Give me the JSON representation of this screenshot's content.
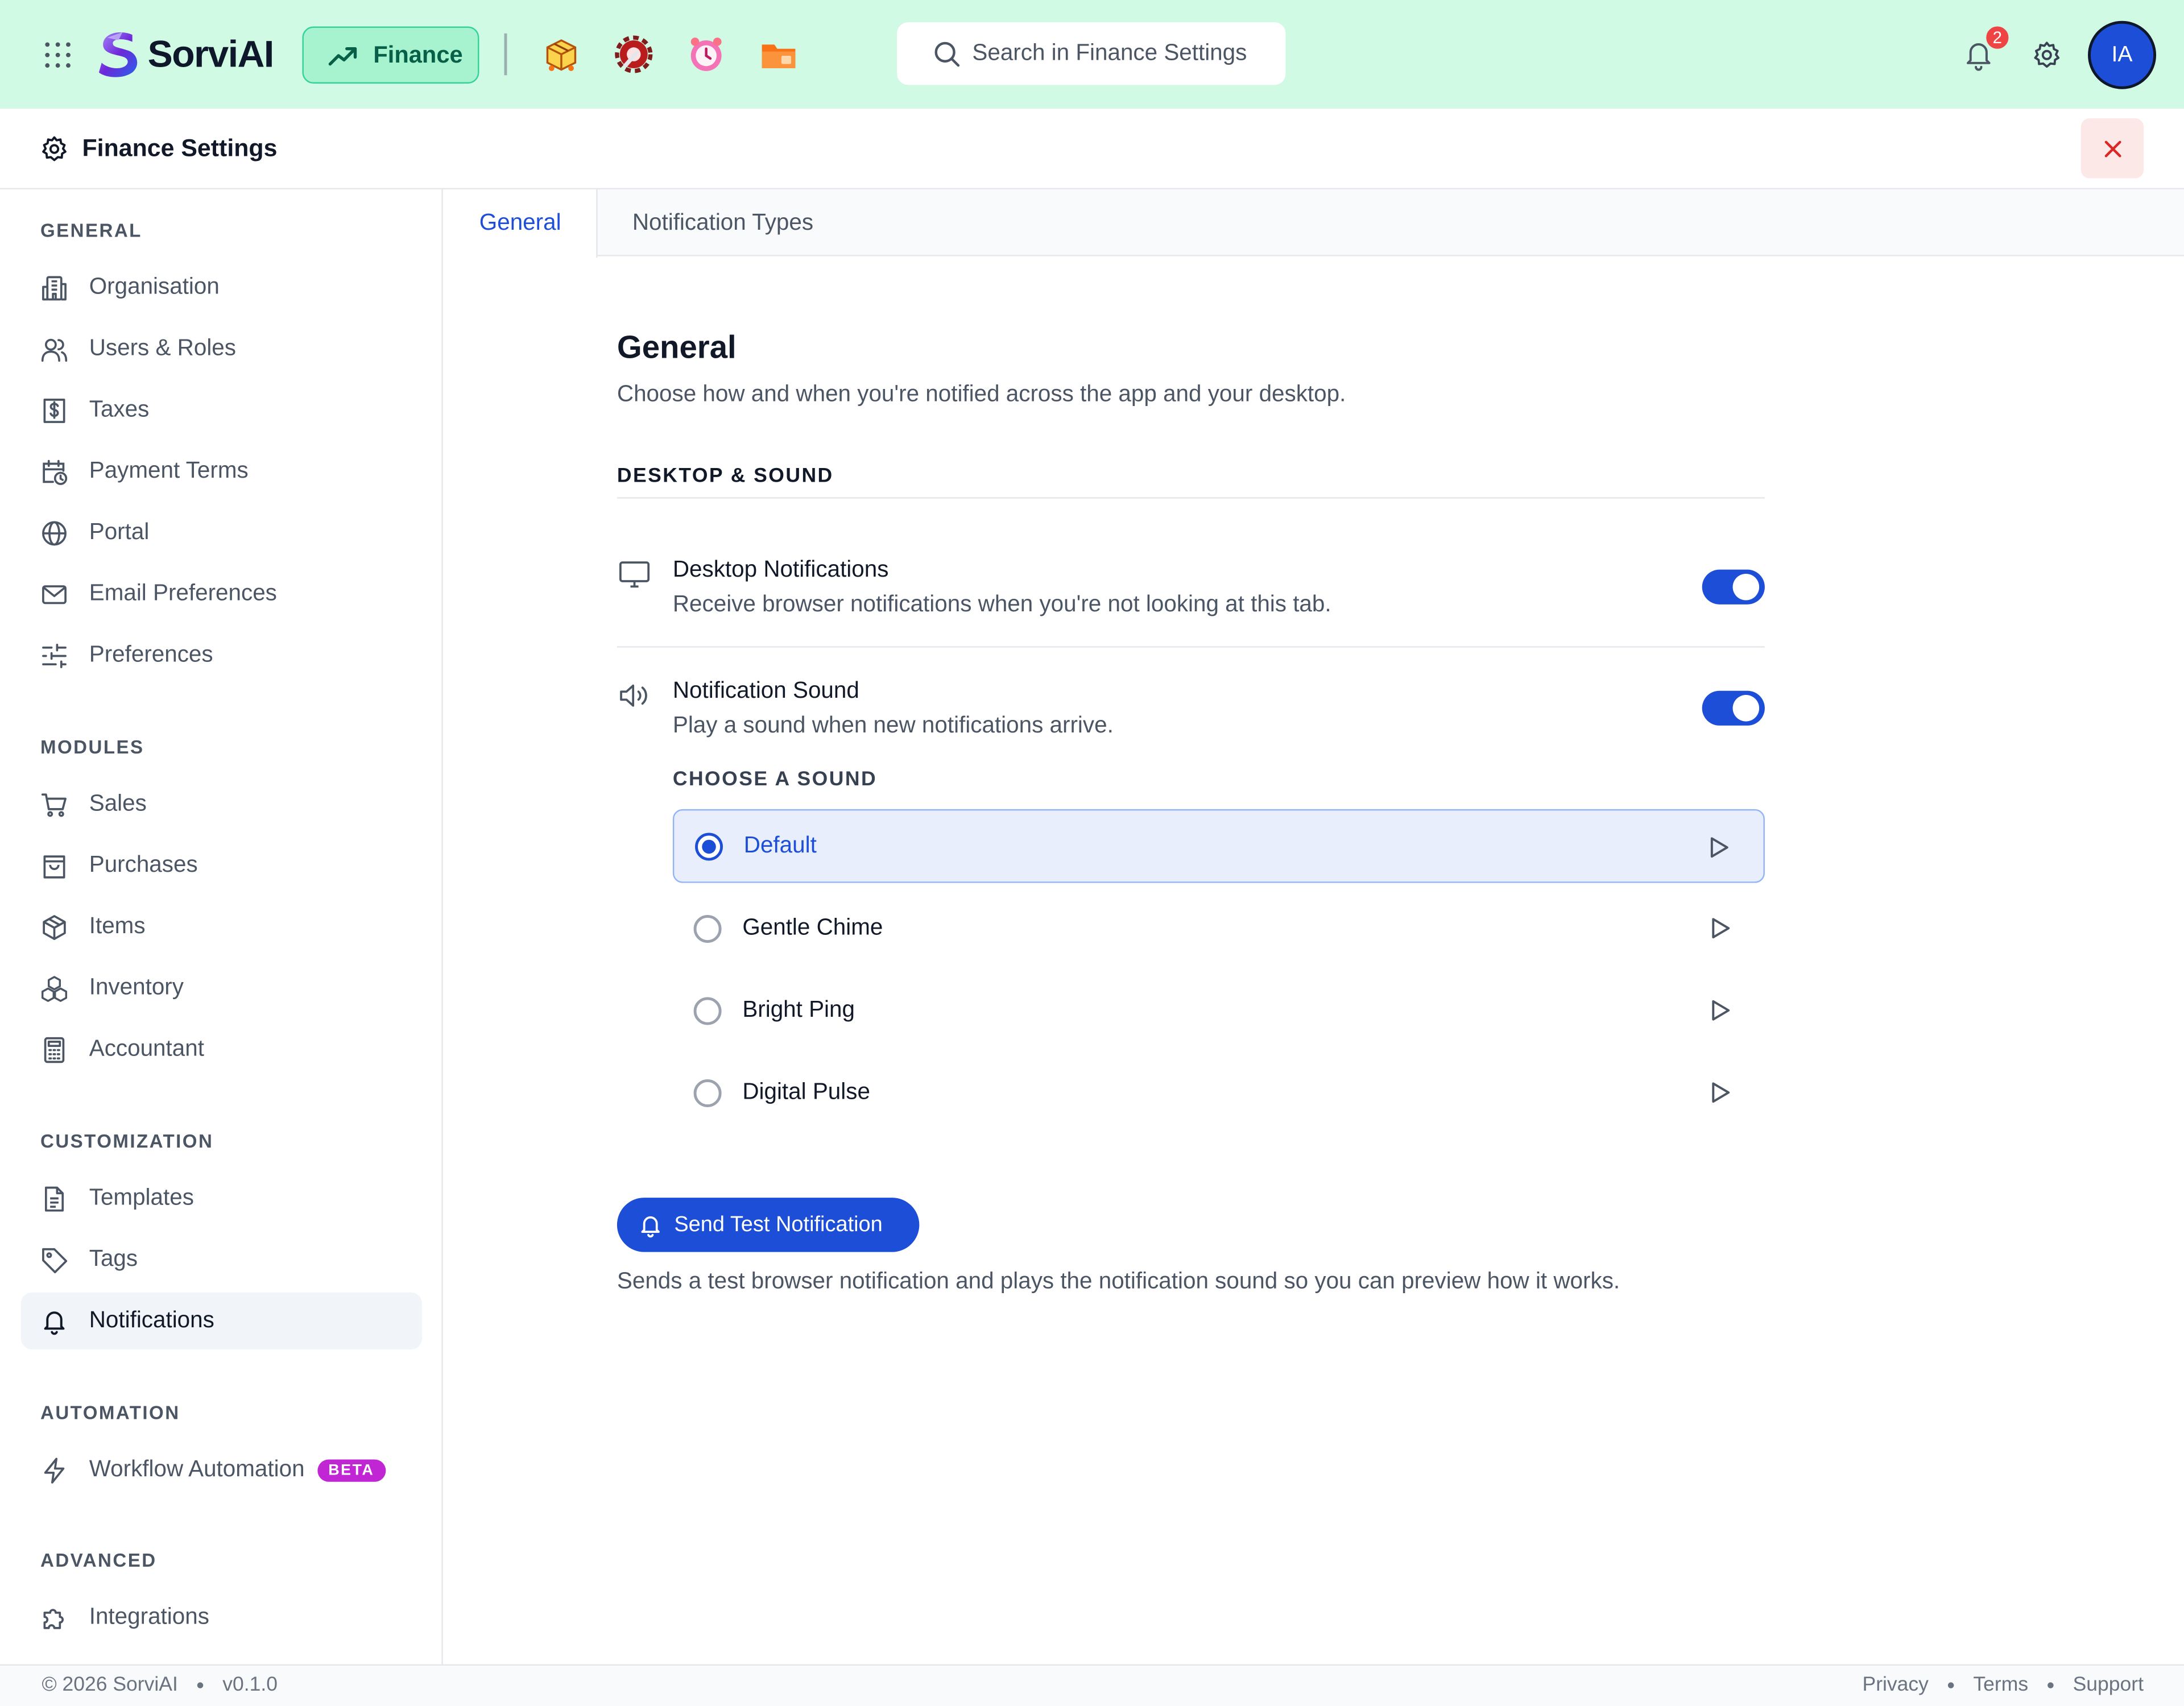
{
  "brand": {
    "name": "SorviAI"
  },
  "topbar": {
    "module_label": "Finance",
    "search_placeholder": "Search in Finance Settings",
    "notification_count": "2",
    "avatar_initials": "IA",
    "quick_apps": [
      "package-app-icon",
      "tools-app-icon",
      "clock-app-icon",
      "folder-app-icon"
    ]
  },
  "header": {
    "title": "Finance Settings"
  },
  "sidebar": {
    "sections": [
      {
        "title": "GENERAL"
      },
      {
        "title": "MODULES"
      },
      {
        "title": "CUSTOMIZATION"
      },
      {
        "title": "AUTOMATION"
      },
      {
        "title": "ADVANCED"
      }
    ],
    "items": [
      {
        "label": "Organisation",
        "icon": "building-icon"
      },
      {
        "label": "Users & Roles",
        "icon": "users-icon"
      },
      {
        "label": "Taxes",
        "icon": "dollar-receipt-icon"
      },
      {
        "label": "Payment Terms",
        "icon": "calendar-clock-icon"
      },
      {
        "label": "Portal",
        "icon": "globe-icon"
      },
      {
        "label": "Email Preferences",
        "icon": "mail-icon"
      },
      {
        "label": "Preferences",
        "icon": "sliders-icon"
      },
      {
        "label": "Sales",
        "icon": "cart-icon"
      },
      {
        "label": "Purchases",
        "icon": "shopping-bag-icon"
      },
      {
        "label": "Items",
        "icon": "box-icon"
      },
      {
        "label": "Inventory",
        "icon": "boxes-icon"
      },
      {
        "label": "Accountant",
        "icon": "calculator-icon"
      },
      {
        "label": "Templates",
        "icon": "document-icon"
      },
      {
        "label": "Tags",
        "icon": "tag-icon"
      },
      {
        "label": "Notifications",
        "icon": "bell-icon",
        "active": true
      },
      {
        "label": "Workflow Automation",
        "icon": "lightning-icon",
        "badge": "BETA"
      },
      {
        "label": "Integrations",
        "icon": "puzzle-icon"
      }
    ]
  },
  "tabs": [
    {
      "label": "General",
      "active": true
    },
    {
      "label": "Notification Types"
    }
  ],
  "main": {
    "title": "General",
    "subtitle": "Choose how and when you're notified across the app and your desktop.",
    "group_title": "DESKTOP & SOUND",
    "desktop": {
      "title": "Desktop Notifications",
      "description": "Receive browser notifications when you're not looking at this tab.",
      "enabled": true
    },
    "sound": {
      "title": "Notification Sound",
      "description": "Play a sound when new notifications arrive.",
      "enabled": true,
      "choose_label": "CHOOSE A SOUND",
      "options": [
        {
          "label": "Default",
          "selected": true
        },
        {
          "label": "Gentle Chime"
        },
        {
          "label": "Bright Ping"
        },
        {
          "label": "Digital Pulse"
        }
      ]
    },
    "test_button": "Send Test Notification",
    "test_help": "Sends a test browser notification and plays the notification sound so you can preview how it works."
  },
  "footer": {
    "copyright": "© 2026 SorviAI",
    "version": "v0.1.0",
    "links": [
      "Privacy",
      "Terms",
      "Support"
    ]
  },
  "colors": {
    "topbar_bg": "#d1fae5",
    "accent": "#1d4ed8",
    "module_pill": "#a7f3d0",
    "badge_red": "#ef4444",
    "beta_badge": "#c026d3"
  }
}
